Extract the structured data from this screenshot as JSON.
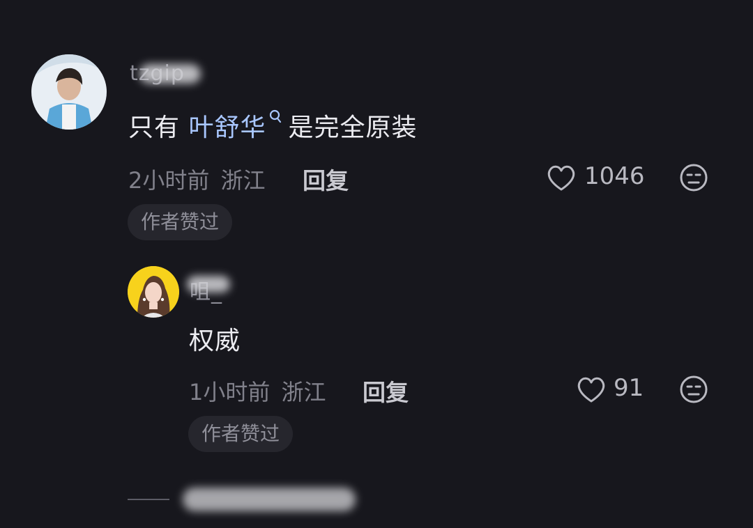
{
  "comment1": {
    "username": "tzgip",
    "text_before": "只有 ",
    "highlight": "叶舒华",
    "text_after": "是完全原装",
    "time": "2小时前",
    "location": "浙江",
    "reply_label": "回复",
    "likes": "1046",
    "badge": "作者赞过"
  },
  "comment2": {
    "username": "咀_",
    "text": "权威",
    "time": "1小时前",
    "location": "浙江",
    "reply_label": "回复",
    "likes": "91",
    "badge": "作者赞过"
  },
  "icons": {
    "like": "heart-outline-icon",
    "dislike": "unhappy-face-icon",
    "search": "search-icon"
  },
  "colors": {
    "background": "#17171d",
    "highlight": "#a9c7ff",
    "avatar2_ring": "#f7d21c"
  }
}
